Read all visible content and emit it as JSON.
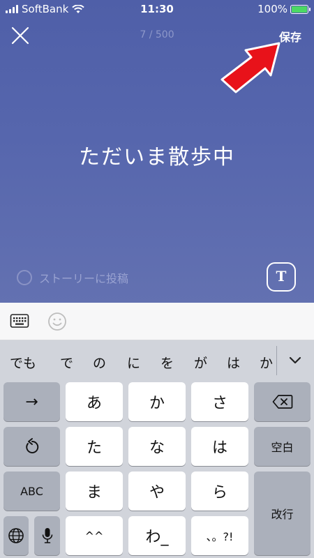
{
  "status_bar": {
    "carrier": "SoftBank",
    "time": "11:30",
    "battery": "100%"
  },
  "editor": {
    "counter": "7 / 500",
    "save_label": "保存",
    "text": "ただいま散歩中",
    "story_label": "ストーリーに投稿",
    "text_style_label": "T"
  },
  "candidates": [
    "でも",
    "で",
    "の",
    "に",
    "を",
    "が",
    "は",
    "か"
  ],
  "keyboard": {
    "row1": [
      "→",
      "あ",
      "か",
      "さ"
    ],
    "row2": [
      "た",
      "な",
      "は",
      "空白"
    ],
    "row3": [
      "ABC",
      "ま",
      "や",
      "ら",
      "改行"
    ],
    "row4": [
      "^^",
      "わ_",
      "、。?!"
    ]
  },
  "colors": {
    "editor_bg": "#5666ad",
    "accent_arrow": "#e8121a"
  }
}
